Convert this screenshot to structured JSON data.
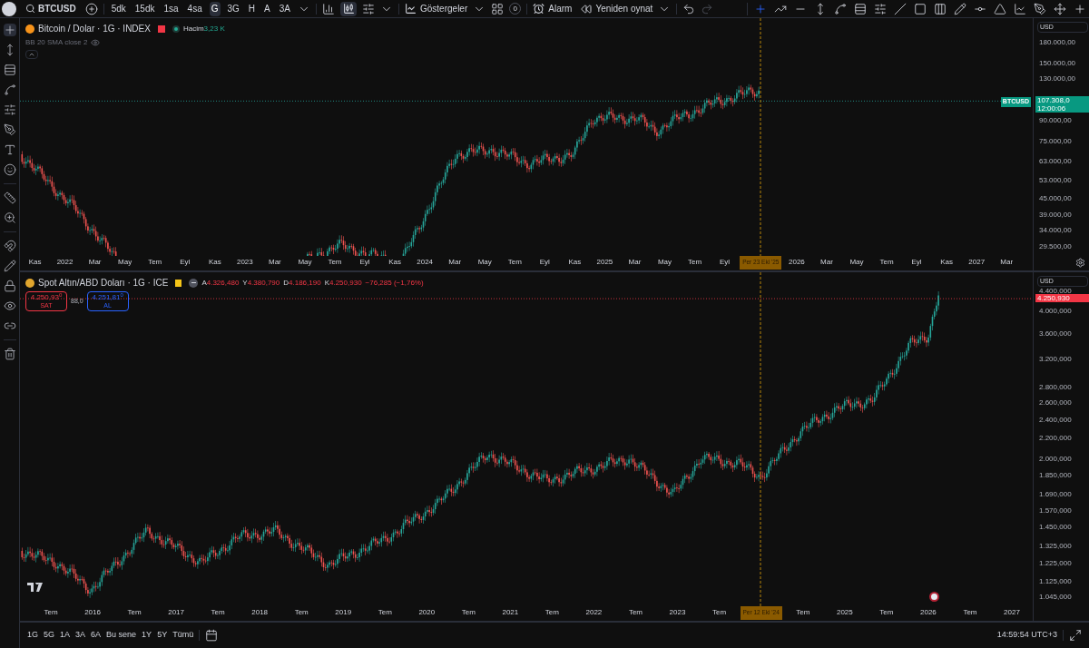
{
  "toolbar": {
    "symbol": "BTCUSD",
    "intervals": [
      {
        "label": "5dk",
        "selected": false
      },
      {
        "label": "15dk",
        "selected": false
      },
      {
        "label": "1sa",
        "selected": false
      },
      {
        "label": "4sa",
        "selected": false
      },
      {
        "label": "G",
        "selected": true
      },
      {
        "label": "3G",
        "selected": false
      },
      {
        "label": "H",
        "selected": false
      },
      {
        "label": "A",
        "selected": false
      },
      {
        "label": "3A",
        "selected": false
      }
    ],
    "indicators_button": "Göstergeler",
    "alert_count": "0",
    "alarm_button": "Alarm",
    "replay_button": "Yeniden oynat"
  },
  "panes": [
    {
      "kind": "btc",
      "title": "Bitcoin / Dolar · 1G · INDEX",
      "volume_label": "Hacim",
      "volume_value": "3,23 K",
      "indicator": "BB 20 SMA close 2",
      "currency": "USD",
      "price_ticks": [
        "180.000,00",
        "150.000,00",
        "130.000,00",
        "90.000,00",
        "75.000,00",
        "63.000,00",
        "53.000,00",
        "45.000,00",
        "39.000,00",
        "34.000,00",
        "29.500,00"
      ],
      "symbol_tag": "BTCUSD",
      "last_price": "107.308,0",
      "countdown": "12:00:06",
      "time_ticks": [
        {
          "kind": "tick",
          "label": "Kas"
        },
        {
          "kind": "tick",
          "label": "2022"
        },
        {
          "kind": "tick",
          "label": "Mar"
        },
        {
          "kind": "tick",
          "label": "May"
        },
        {
          "kind": "tick",
          "label": "Tem"
        },
        {
          "kind": "tick",
          "label": "Eyl"
        },
        {
          "kind": "tick",
          "label": "Kas"
        },
        {
          "kind": "tick",
          "label": "2023"
        },
        {
          "kind": "tick",
          "label": "Mar"
        },
        {
          "kind": "tick",
          "label": "May"
        },
        {
          "kind": "tick",
          "label": "Tem"
        },
        {
          "kind": "tick",
          "label": "Eyl"
        },
        {
          "kind": "tick",
          "label": "Kas"
        },
        {
          "kind": "tick",
          "label": "2024"
        },
        {
          "kind": "tick",
          "label": "Mar"
        },
        {
          "kind": "tick",
          "label": "May"
        },
        {
          "kind": "tick",
          "label": "Tem"
        },
        {
          "kind": "tick",
          "label": "Eyl"
        },
        {
          "kind": "tick",
          "label": "Kas"
        },
        {
          "kind": "tick",
          "label": "2025"
        },
        {
          "kind": "tick",
          "label": "Mar"
        },
        {
          "kind": "tick",
          "label": "May"
        },
        {
          "kind": "tick",
          "label": "Tem"
        },
        {
          "kind": "tick",
          "label": "Eyl"
        },
        {
          "kind": "crosshair",
          "label": "Per 23 Eki '25"
        },
        {
          "kind": "tick",
          "label": "2026"
        },
        {
          "kind": "tick",
          "label": "Mar"
        },
        {
          "kind": "tick",
          "label": "May"
        },
        {
          "kind": "tick",
          "label": "Tem"
        },
        {
          "kind": "tick",
          "label": "Eyl"
        },
        {
          "kind": "tick",
          "label": "Kas"
        },
        {
          "kind": "tick",
          "label": "2027"
        },
        {
          "kind": "tick",
          "label": "Mar"
        }
      ]
    },
    {
      "kind": "gold",
      "title": "Spot Altın/ABD Doları · 1G · ICE",
      "ohlc": [
        {
          "key": "A",
          "value": "4.326,480"
        },
        {
          "key": "Y",
          "value": "4.380,790"
        },
        {
          "key": "D",
          "value": "4.186,190"
        },
        {
          "key": "K",
          "value": "4.250,930"
        }
      ],
      "change": "−76,285 (−1,76%)",
      "sell": {
        "price": "4.250,93$^{0}$",
        "label": "SAT"
      },
      "spread": "88,0",
      "buy": {
        "price": "4.251,81$^{0}$",
        "label": "AL"
      },
      "currency": "USD",
      "price_ticks": [
        "4.400,000",
        "4.000,000",
        "3.600,000",
        "3.200,000",
        "2.800,000",
        "2.600,000",
        "2.400,000",
        "2.200,000",
        "2.000,000",
        "1.850,000",
        "1.690,000",
        "1.570,000",
        "1.450,000",
        "1.325,000",
        "1.225,000",
        "1.125,000",
        "1.045,000"
      ],
      "last_price": "4.250,930",
      "time_ticks": [
        {
          "kind": "tick",
          "label": "Tem"
        },
        {
          "kind": "tick",
          "label": "2016"
        },
        {
          "kind": "tick",
          "label": "Tem"
        },
        {
          "kind": "tick",
          "label": "2017"
        },
        {
          "kind": "tick",
          "label": "Tem"
        },
        {
          "kind": "tick",
          "label": "2018"
        },
        {
          "kind": "tick",
          "label": "Tem"
        },
        {
          "kind": "tick",
          "label": "2019"
        },
        {
          "kind": "tick",
          "label": "Tem"
        },
        {
          "kind": "tick",
          "label": "2020"
        },
        {
          "kind": "tick",
          "label": "Tem"
        },
        {
          "kind": "tick",
          "label": "2021"
        },
        {
          "kind": "tick",
          "label": "Tem"
        },
        {
          "kind": "tick",
          "label": "2022"
        },
        {
          "kind": "tick",
          "label": "Tem"
        },
        {
          "kind": "tick",
          "label": "2023"
        },
        {
          "kind": "tick",
          "label": "Tem"
        },
        {
          "kind": "crosshair",
          "label": "Per 12 Eki '24"
        },
        {
          "kind": "tick",
          "label": "Tem"
        },
        {
          "kind": "tick",
          "label": "2025"
        },
        {
          "kind": "tick",
          "label": "Tem"
        },
        {
          "kind": "tick",
          "label": "2026"
        },
        {
          "kind": "tick",
          "label": "Tem"
        },
        {
          "kind": "tick",
          "label": "2027"
        }
      ]
    }
  ],
  "ranges": [
    {
      "label": "1G"
    },
    {
      "label": "5G"
    },
    {
      "label": "1A"
    },
    {
      "label": "3A"
    },
    {
      "label": "6A"
    },
    {
      "label": "Bu sene"
    },
    {
      "label": "1Y"
    },
    {
      "label": "5Y"
    },
    {
      "label": "Tümü"
    }
  ],
  "clock": "14:59:54 UTC+3"
}
